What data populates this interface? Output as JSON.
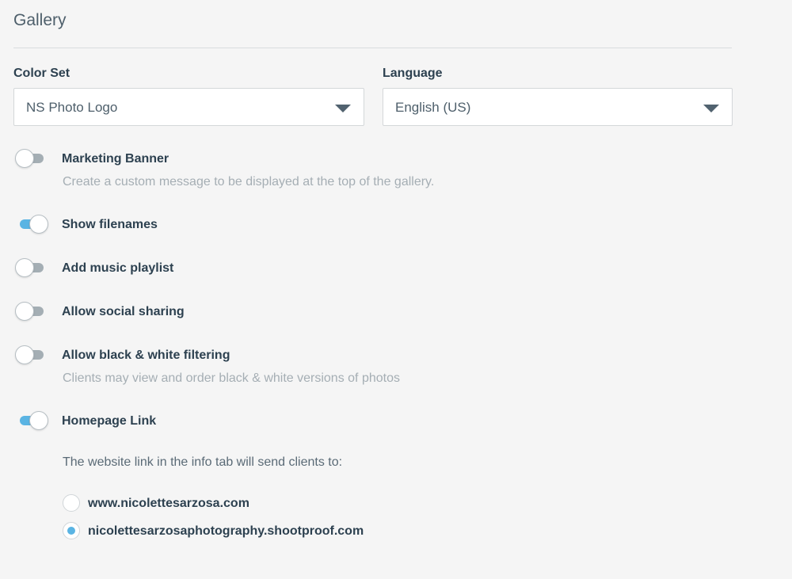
{
  "section": {
    "title": "Gallery"
  },
  "color_set": {
    "label": "Color Set",
    "value": "NS Photo Logo"
  },
  "language": {
    "label": "Language",
    "value": "English (US)"
  },
  "options": {
    "marketing_banner": {
      "title": "Marketing Banner",
      "description": "Create a custom message to be displayed at the top of the gallery.",
      "enabled": false
    },
    "show_filenames": {
      "title": "Show filenames",
      "enabled": true
    },
    "music_playlist": {
      "title": "Add music playlist",
      "enabled": false
    },
    "social_sharing": {
      "title": "Allow social sharing",
      "enabled": false
    },
    "bw_filtering": {
      "title": "Allow black & white filtering",
      "description": "Clients may view and order black & white versions of photos",
      "enabled": false
    },
    "homepage_link": {
      "title": "Homepage Link",
      "enabled": true
    }
  },
  "homepage": {
    "prompt": "The website link in the info tab will send clients to:",
    "choices": [
      {
        "label": "www.nicolettesarzosa.com",
        "selected": false
      },
      {
        "label": "nicolettesarzosaphotography.shootproof.com",
        "selected": true
      }
    ]
  },
  "colors": {
    "accent": "#5ab4e3",
    "toggle_off": "#a4aeb4",
    "text": "#2d4150",
    "muted": "#a5aeb4"
  },
  "icons": {
    "select_caret": "caret-down-icon"
  }
}
